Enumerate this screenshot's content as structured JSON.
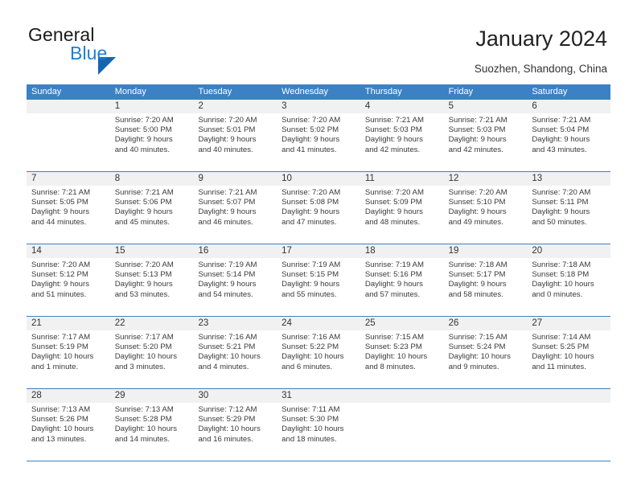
{
  "brand": {
    "name_part1": "General",
    "name_part2": "Blue",
    "accent_color": "#1c7fd4",
    "triangle_color": "#1566b0"
  },
  "header": {
    "title": "January 2024",
    "subtitle": "Suozhen, Shandong, China"
  },
  "calendar": {
    "header_bg": "#3b81c4",
    "weekdays": [
      "Sunday",
      "Monday",
      "Tuesday",
      "Wednesday",
      "Thursday",
      "Friday",
      "Saturday"
    ],
    "weeks": [
      [
        {
          "day": "",
          "sunrise": "",
          "sunset": "",
          "daylight1": "",
          "daylight2": ""
        },
        {
          "day": "1",
          "sunrise": "Sunrise: 7:20 AM",
          "sunset": "Sunset: 5:00 PM",
          "daylight1": "Daylight: 9 hours",
          "daylight2": "and 40 minutes."
        },
        {
          "day": "2",
          "sunrise": "Sunrise: 7:20 AM",
          "sunset": "Sunset: 5:01 PM",
          "daylight1": "Daylight: 9 hours",
          "daylight2": "and 40 minutes."
        },
        {
          "day": "3",
          "sunrise": "Sunrise: 7:20 AM",
          "sunset": "Sunset: 5:02 PM",
          "daylight1": "Daylight: 9 hours",
          "daylight2": "and 41 minutes."
        },
        {
          "day": "4",
          "sunrise": "Sunrise: 7:21 AM",
          "sunset": "Sunset: 5:03 PM",
          "daylight1": "Daylight: 9 hours",
          "daylight2": "and 42 minutes."
        },
        {
          "day": "5",
          "sunrise": "Sunrise: 7:21 AM",
          "sunset": "Sunset: 5:03 PM",
          "daylight1": "Daylight: 9 hours",
          "daylight2": "and 42 minutes."
        },
        {
          "day": "6",
          "sunrise": "Sunrise: 7:21 AM",
          "sunset": "Sunset: 5:04 PM",
          "daylight1": "Daylight: 9 hours",
          "daylight2": "and 43 minutes."
        }
      ],
      [
        {
          "day": "7",
          "sunrise": "Sunrise: 7:21 AM",
          "sunset": "Sunset: 5:05 PM",
          "daylight1": "Daylight: 9 hours",
          "daylight2": "and 44 minutes."
        },
        {
          "day": "8",
          "sunrise": "Sunrise: 7:21 AM",
          "sunset": "Sunset: 5:06 PM",
          "daylight1": "Daylight: 9 hours",
          "daylight2": "and 45 minutes."
        },
        {
          "day": "9",
          "sunrise": "Sunrise: 7:21 AM",
          "sunset": "Sunset: 5:07 PM",
          "daylight1": "Daylight: 9 hours",
          "daylight2": "and 46 minutes."
        },
        {
          "day": "10",
          "sunrise": "Sunrise: 7:20 AM",
          "sunset": "Sunset: 5:08 PM",
          "daylight1": "Daylight: 9 hours",
          "daylight2": "and 47 minutes."
        },
        {
          "day": "11",
          "sunrise": "Sunrise: 7:20 AM",
          "sunset": "Sunset: 5:09 PM",
          "daylight1": "Daylight: 9 hours",
          "daylight2": "and 48 minutes."
        },
        {
          "day": "12",
          "sunrise": "Sunrise: 7:20 AM",
          "sunset": "Sunset: 5:10 PM",
          "daylight1": "Daylight: 9 hours",
          "daylight2": "and 49 minutes."
        },
        {
          "day": "13",
          "sunrise": "Sunrise: 7:20 AM",
          "sunset": "Sunset: 5:11 PM",
          "daylight1": "Daylight: 9 hours",
          "daylight2": "and 50 minutes."
        }
      ],
      [
        {
          "day": "14",
          "sunrise": "Sunrise: 7:20 AM",
          "sunset": "Sunset: 5:12 PM",
          "daylight1": "Daylight: 9 hours",
          "daylight2": "and 51 minutes."
        },
        {
          "day": "15",
          "sunrise": "Sunrise: 7:20 AM",
          "sunset": "Sunset: 5:13 PM",
          "daylight1": "Daylight: 9 hours",
          "daylight2": "and 53 minutes."
        },
        {
          "day": "16",
          "sunrise": "Sunrise: 7:19 AM",
          "sunset": "Sunset: 5:14 PM",
          "daylight1": "Daylight: 9 hours",
          "daylight2": "and 54 minutes."
        },
        {
          "day": "17",
          "sunrise": "Sunrise: 7:19 AM",
          "sunset": "Sunset: 5:15 PM",
          "daylight1": "Daylight: 9 hours",
          "daylight2": "and 55 minutes."
        },
        {
          "day": "18",
          "sunrise": "Sunrise: 7:19 AM",
          "sunset": "Sunset: 5:16 PM",
          "daylight1": "Daylight: 9 hours",
          "daylight2": "and 57 minutes."
        },
        {
          "day": "19",
          "sunrise": "Sunrise: 7:18 AM",
          "sunset": "Sunset: 5:17 PM",
          "daylight1": "Daylight: 9 hours",
          "daylight2": "and 58 minutes."
        },
        {
          "day": "20",
          "sunrise": "Sunrise: 7:18 AM",
          "sunset": "Sunset: 5:18 PM",
          "daylight1": "Daylight: 10 hours",
          "daylight2": "and 0 minutes."
        }
      ],
      [
        {
          "day": "21",
          "sunrise": "Sunrise: 7:17 AM",
          "sunset": "Sunset: 5:19 PM",
          "daylight1": "Daylight: 10 hours",
          "daylight2": "and 1 minute."
        },
        {
          "day": "22",
          "sunrise": "Sunrise: 7:17 AM",
          "sunset": "Sunset: 5:20 PM",
          "daylight1": "Daylight: 10 hours",
          "daylight2": "and 3 minutes."
        },
        {
          "day": "23",
          "sunrise": "Sunrise: 7:16 AM",
          "sunset": "Sunset: 5:21 PM",
          "daylight1": "Daylight: 10 hours",
          "daylight2": "and 4 minutes."
        },
        {
          "day": "24",
          "sunrise": "Sunrise: 7:16 AM",
          "sunset": "Sunset: 5:22 PM",
          "daylight1": "Daylight: 10 hours",
          "daylight2": "and 6 minutes."
        },
        {
          "day": "25",
          "sunrise": "Sunrise: 7:15 AM",
          "sunset": "Sunset: 5:23 PM",
          "daylight1": "Daylight: 10 hours",
          "daylight2": "and 8 minutes."
        },
        {
          "day": "26",
          "sunrise": "Sunrise: 7:15 AM",
          "sunset": "Sunset: 5:24 PM",
          "daylight1": "Daylight: 10 hours",
          "daylight2": "and 9 minutes."
        },
        {
          "day": "27",
          "sunrise": "Sunrise: 7:14 AM",
          "sunset": "Sunset: 5:25 PM",
          "daylight1": "Daylight: 10 hours",
          "daylight2": "and 11 minutes."
        }
      ],
      [
        {
          "day": "28",
          "sunrise": "Sunrise: 7:13 AM",
          "sunset": "Sunset: 5:26 PM",
          "daylight1": "Daylight: 10 hours",
          "daylight2": "and 13 minutes."
        },
        {
          "day": "29",
          "sunrise": "Sunrise: 7:13 AM",
          "sunset": "Sunset: 5:28 PM",
          "daylight1": "Daylight: 10 hours",
          "daylight2": "and 14 minutes."
        },
        {
          "day": "30",
          "sunrise": "Sunrise: 7:12 AM",
          "sunset": "Sunset: 5:29 PM",
          "daylight1": "Daylight: 10 hours",
          "daylight2": "and 16 minutes."
        },
        {
          "day": "31",
          "sunrise": "Sunrise: 7:11 AM",
          "sunset": "Sunset: 5:30 PM",
          "daylight1": "Daylight: 10 hours",
          "daylight2": "and 18 minutes."
        },
        {
          "day": "",
          "sunrise": "",
          "sunset": "",
          "daylight1": "",
          "daylight2": ""
        },
        {
          "day": "",
          "sunrise": "",
          "sunset": "",
          "daylight1": "",
          "daylight2": ""
        },
        {
          "day": "",
          "sunrise": "",
          "sunset": "",
          "daylight1": "",
          "daylight2": ""
        }
      ]
    ]
  }
}
